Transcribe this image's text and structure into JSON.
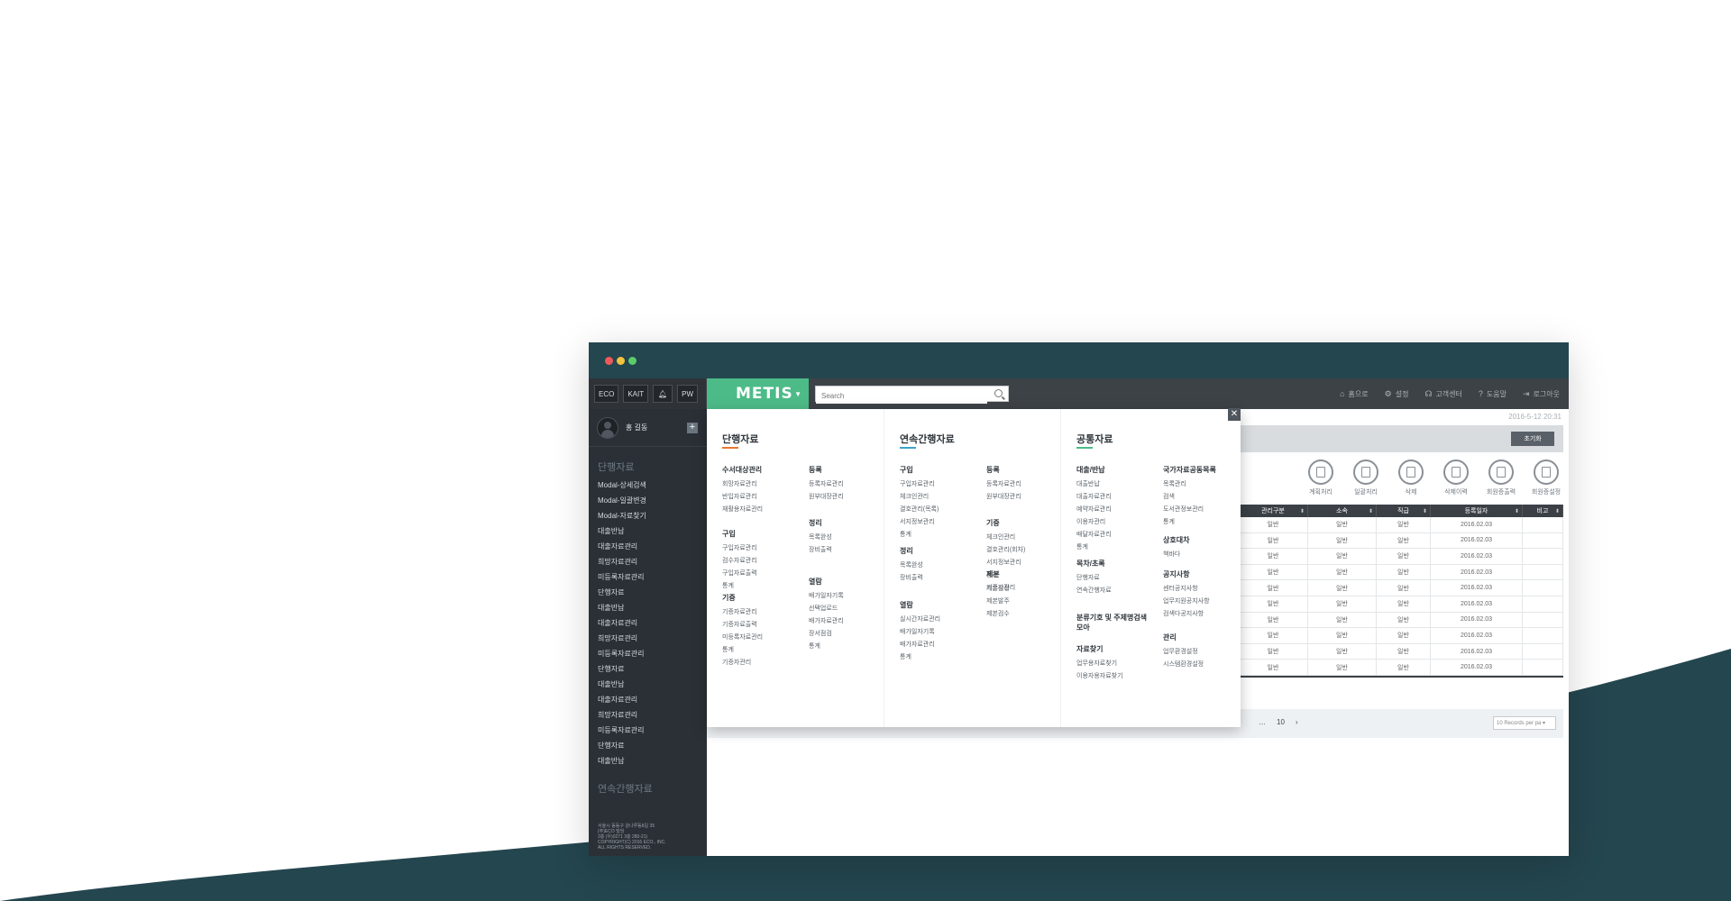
{
  "window": {
    "controls": [
      "close",
      "minimize",
      "maximize"
    ]
  },
  "quick_buttons": [
    "ECO",
    "KAIT",
    "PW"
  ],
  "app": {
    "logo": "METIS"
  },
  "search": {
    "placeholder": "Search"
  },
  "topnav": [
    {
      "label": "홈으로",
      "icon": "home-icon",
      "glyph": "⌂"
    },
    {
      "label": "설정",
      "icon": "gear-icon",
      "glyph": "⚙"
    },
    {
      "label": "고객센터",
      "icon": "headset-icon",
      "glyph": "☊"
    },
    {
      "label": "도움말",
      "icon": "help-icon",
      "glyph": "?"
    },
    {
      "label": "로그아웃",
      "icon": "logout-icon",
      "glyph": "⇥"
    }
  ],
  "sidebar": {
    "username": "홍 길동",
    "section1": "단행자료",
    "items": [
      "Modal-상세검색",
      "Modal-일괄변경",
      "Modal-자료찾기",
      "대출반납",
      "대출자료관리",
      "희망자료관리",
      "미등록자료관리",
      "단행자료",
      "대출반납",
      "대출자료관리",
      "희망자료관리",
      "미등록자료관리",
      "단행자료",
      "대출반납",
      "대출자료관리",
      "희망자료관리",
      "미등록자료관리",
      "단행자료",
      "대출반납"
    ],
    "section2": "연속간행자료",
    "footer": [
      "서울시 동동구 강나루동8길 35",
      "(주)ECO 빌딩",
      "3층 (우)0271 3층 280-21)",
      "COPYRIGHT(C) 2016 ECO., INC.",
      "ALL RIGHTS RESERVED."
    ]
  },
  "main": {
    "datetime": "2016-5-12 20:31",
    "reset_label": "초기화",
    "actions": [
      "계획처리",
      "일괄처리",
      "삭제",
      "삭제이력",
      "회원증출력",
      "회원증설정"
    ],
    "columns": [
      "관리구분",
      "소속",
      "직급",
      "등록일자",
      "비고"
    ],
    "rows": [
      [
        "일반",
        "일반",
        "일반",
        "2016.02.03",
        ""
      ],
      [
        "일반",
        "일반",
        "일반",
        "2016.02.03",
        ""
      ],
      [
        "일반",
        "일반",
        "일반",
        "2016.02.03",
        ""
      ],
      [
        "일반",
        "일반",
        "일반",
        "2016.02.03",
        ""
      ],
      [
        "일반",
        "일반",
        "일반",
        "2016.02.03",
        ""
      ],
      [
        "일반",
        "일반",
        "일반",
        "2016.02.03",
        ""
      ],
      [
        "일반",
        "일반",
        "일반",
        "2016.02.03",
        ""
      ],
      [
        "일반",
        "일반",
        "일반",
        "2016.02.03",
        ""
      ],
      [
        "일반",
        "일반",
        "일반",
        "2016.02.03",
        ""
      ],
      [
        "일반",
        "일반",
        "일반",
        "2016.02.03",
        ""
      ]
    ],
    "pager": {
      "dots": "…",
      "page": "10",
      "next": "›"
    },
    "per_page": "10 Records per pa ▾"
  },
  "mega_menu": {
    "columns": [
      {
        "title": "단행자료",
        "color": "#e8782e",
        "groups": [
          {
            "title": "수서대상관리",
            "items": [
              "회망자료관리",
              "반입자료관리",
              "재활용자료관리"
            ]
          },
          {
            "title": "등록",
            "items": [
              "등록자료관리",
              "원부대장관리"
            ]
          },
          {
            "title": "구입",
            "items": [
              "구입자료관리",
              "검수자료관리",
              "구입자료출력",
              "통계"
            ]
          },
          {
            "title": "정리",
            "items": [
              "목록완성",
              "장비출력"
            ]
          },
          {
            "title": "기증",
            "items": [
              "기증자료관리",
              "기증자료출력",
              "미등록자료관리",
              "통계",
              "기증자관리"
            ]
          },
          {
            "title": "열람",
            "items": [
              "배가일자기록",
              "선택업로드",
              "배가자료관리",
              "장서점검",
              "통계"
            ]
          }
        ]
      },
      {
        "title": "연속간행자료",
        "color": "#3aa3c9",
        "groups": [
          {
            "title": "구입",
            "items": [
              "구입자료관리",
              "체크인관리",
              "결호관리(목록)",
              "서지정보관리",
              "통계"
            ]
          },
          {
            "title": "등록",
            "items": [
              "등록자료관리",
              "원부대장관리"
            ]
          },
          {
            "title": "정리",
            "items": [
              "목록완성",
              "장비출력"
            ]
          },
          {
            "title": "기증",
            "items": [
              "체크인관리",
              "결호관리(회차)",
              "서지정보관리",
              "통계",
              "기증자관리"
            ]
          },
          {
            "title": "열람",
            "items": [
              "실시간자료관리",
              "배가일자기록",
              "배가자료관리",
              "통계"
            ]
          },
          {
            "title": "제본",
            "items": [
              "제본설정",
              "제본발주",
              "제본검수"
            ]
          }
        ]
      },
      {
        "title": "공통자료",
        "color": "#4dbb88",
        "groups": [
          {
            "title": "대출/반납",
            "items": [
              "대출반납",
              "대출자료관리",
              "예약자료관리",
              "이용자관리",
              "배달자료관리",
              "통계"
            ]
          },
          {
            "title": "국가자료공동목록",
            "items": [
              "목록관리",
              "검색",
              "도서관정보관리",
              "통계"
            ]
          },
          {
            "title": "상호대차",
            "items": [
              "책바다"
            ]
          },
          {
            "title": "목차/초록",
            "items": [
              "단행자료",
              "연속간행자료"
            ]
          },
          {
            "title": "공지사항",
            "items": [
              "센터공지사항",
              "업무지원공지사항",
              "검색다공지사항"
            ]
          },
          {
            "title": "분류기호 및 주제명검색모아",
            "items": []
          },
          {
            "title": "자료찾기",
            "items": [
              "업무용자료찾기",
              "이용자용자료찾기"
            ]
          },
          {
            "title": "관리",
            "items": [
              "업무환경설정",
              "시스템환경설정"
            ]
          }
        ]
      }
    ]
  }
}
